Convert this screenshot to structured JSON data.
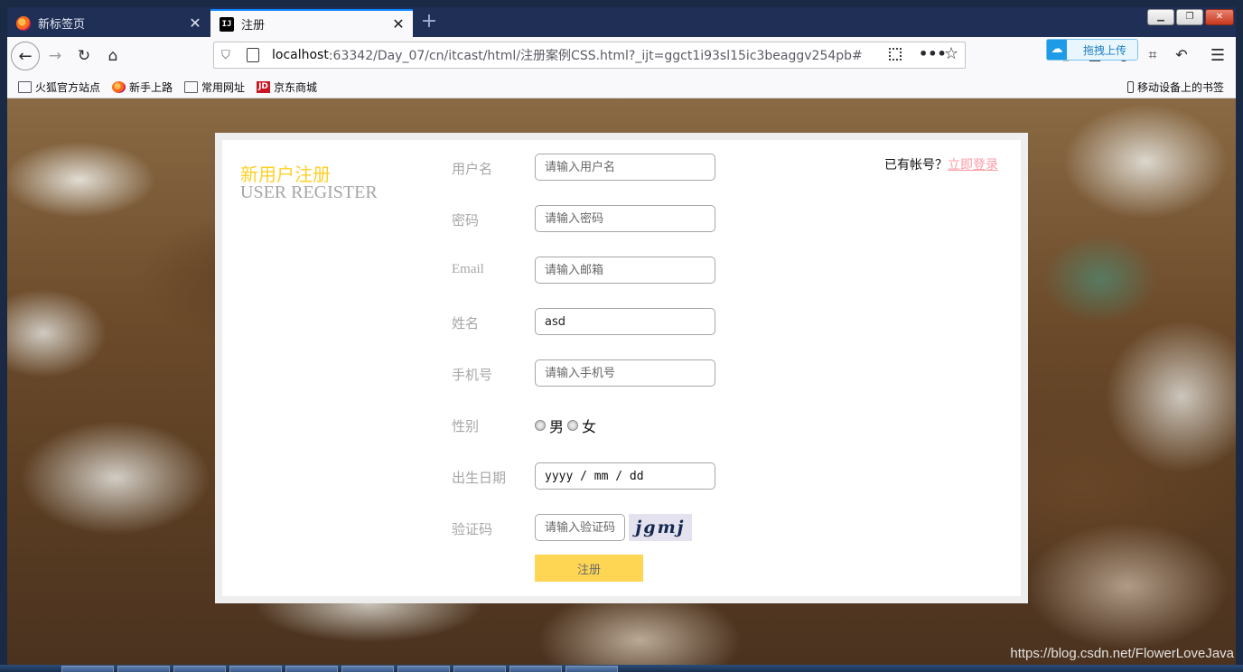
{
  "tabs": [
    {
      "label": "新标签页",
      "active": false
    },
    {
      "label": "注册",
      "active": true
    }
  ],
  "url": {
    "host": "localhost",
    "path": ":63342/Day_07/cn/itcast/html/注册案例CSS.html?_ijt=ggct1i93sl15ic3beaggv254pb#"
  },
  "baidu_upload_label": "拖拽上传",
  "bookmarks": [
    "火狐官方站点",
    "新手上路",
    "常用网址",
    "京东商城"
  ],
  "mobile_bookmarks": "移动设备上的书签",
  "form": {
    "title_cn": "新用户注册",
    "title_en": "USER REGISTER",
    "fields": {
      "username": {
        "label": "用户名",
        "placeholder": "请输入用户名",
        "value": ""
      },
      "password": {
        "label": "密码",
        "placeholder": "请输入密码",
        "value": ""
      },
      "email": {
        "label": "Email",
        "placeholder": "请输入邮箱",
        "value": ""
      },
      "name": {
        "label": "姓名",
        "placeholder": "",
        "value": "asd"
      },
      "phone": {
        "label": "手机号",
        "placeholder": "请输入手机号",
        "value": ""
      },
      "gender": {
        "label": "性别",
        "options": [
          "男",
          "女"
        ]
      },
      "birthday": {
        "label": "出生日期",
        "value": "yyyy / mm / dd"
      },
      "captcha": {
        "label": "验证码",
        "placeholder": "请输入验证码",
        "image_text": "jgmj"
      }
    },
    "submit_label": "注册",
    "login_prompt": "已有帐号？",
    "login_link": "立即登录"
  },
  "watermark": "https://blog.csdn.net/FlowerLoveJava",
  "colors": {
    "title_accent": "#ffd026",
    "submit_bg": "#ffd654",
    "login_link": "#ff9aa4",
    "label_gray": "#a6a6a6"
  }
}
